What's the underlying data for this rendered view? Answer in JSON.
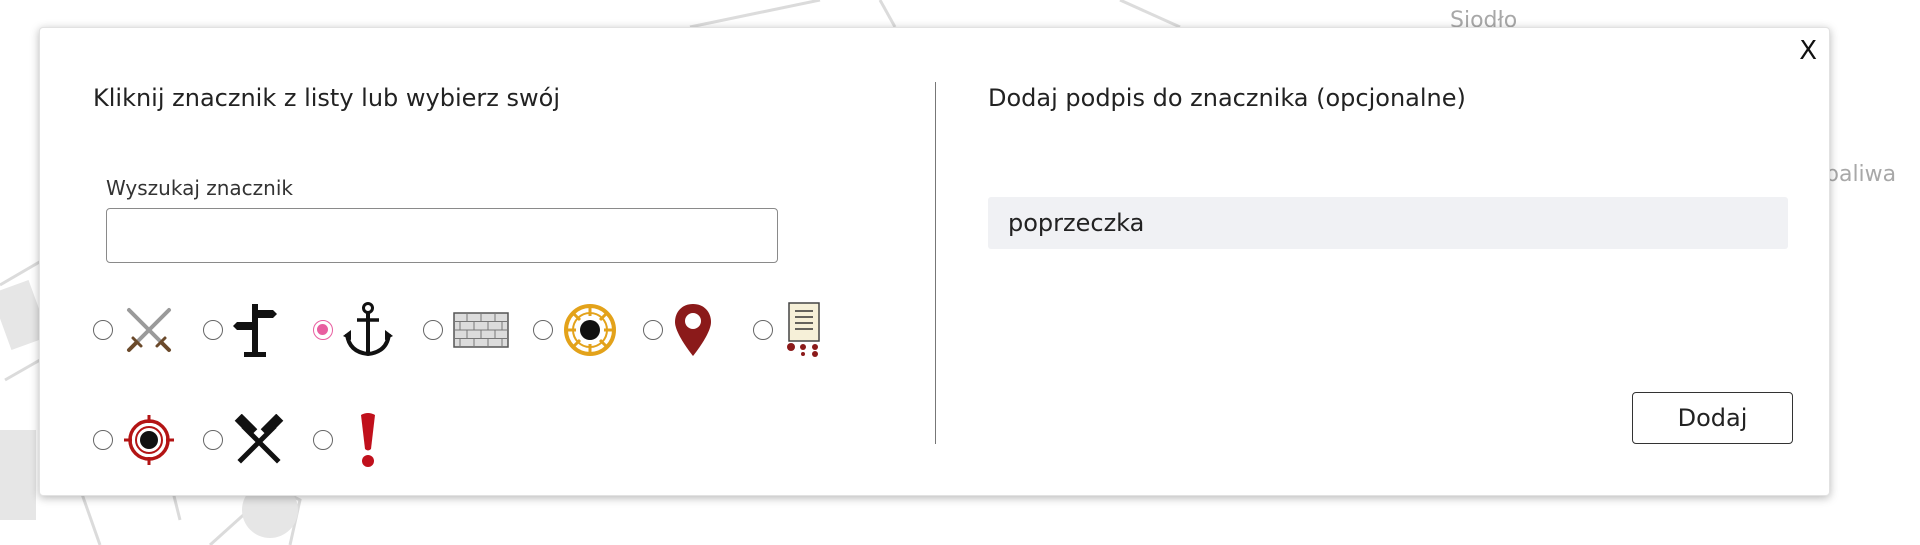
{
  "background": {
    "label_top": "Siodło",
    "label_right": "paliwa"
  },
  "modal": {
    "close_label": "X",
    "left": {
      "heading": "Kliknij znacznik z listy lub wybierz swój",
      "search_label": "Wyszukaj znacznik",
      "search_value": "",
      "markers": [
        {
          "icon": "crossed-swords-icon",
          "selected": false
        },
        {
          "icon": "signpost-icon",
          "selected": false
        },
        {
          "icon": "anchor-icon",
          "selected": true
        },
        {
          "icon": "brick-wall-icon",
          "selected": false
        },
        {
          "icon": "ship-wheel-icon",
          "selected": false
        },
        {
          "icon": "location-pin-icon",
          "selected": false
        },
        {
          "icon": "notice-board-icon",
          "selected": false
        },
        {
          "icon": "target-icon",
          "selected": false
        },
        {
          "icon": "hammers-icon",
          "selected": false
        },
        {
          "icon": "exclamation-icon",
          "selected": false
        }
      ]
    },
    "right": {
      "heading": "Dodaj podpis do znacznika (opcjonalne)",
      "caption_value": "poprzeczka",
      "add_label": "Dodaj"
    }
  },
  "colors": {
    "radio_selected": "#e85ea0",
    "wheel_orange": "#e3a21a",
    "marker_dark_red": "#8b1a1a",
    "exclamation_red": "#c0101c",
    "target_red": "#b31414"
  }
}
